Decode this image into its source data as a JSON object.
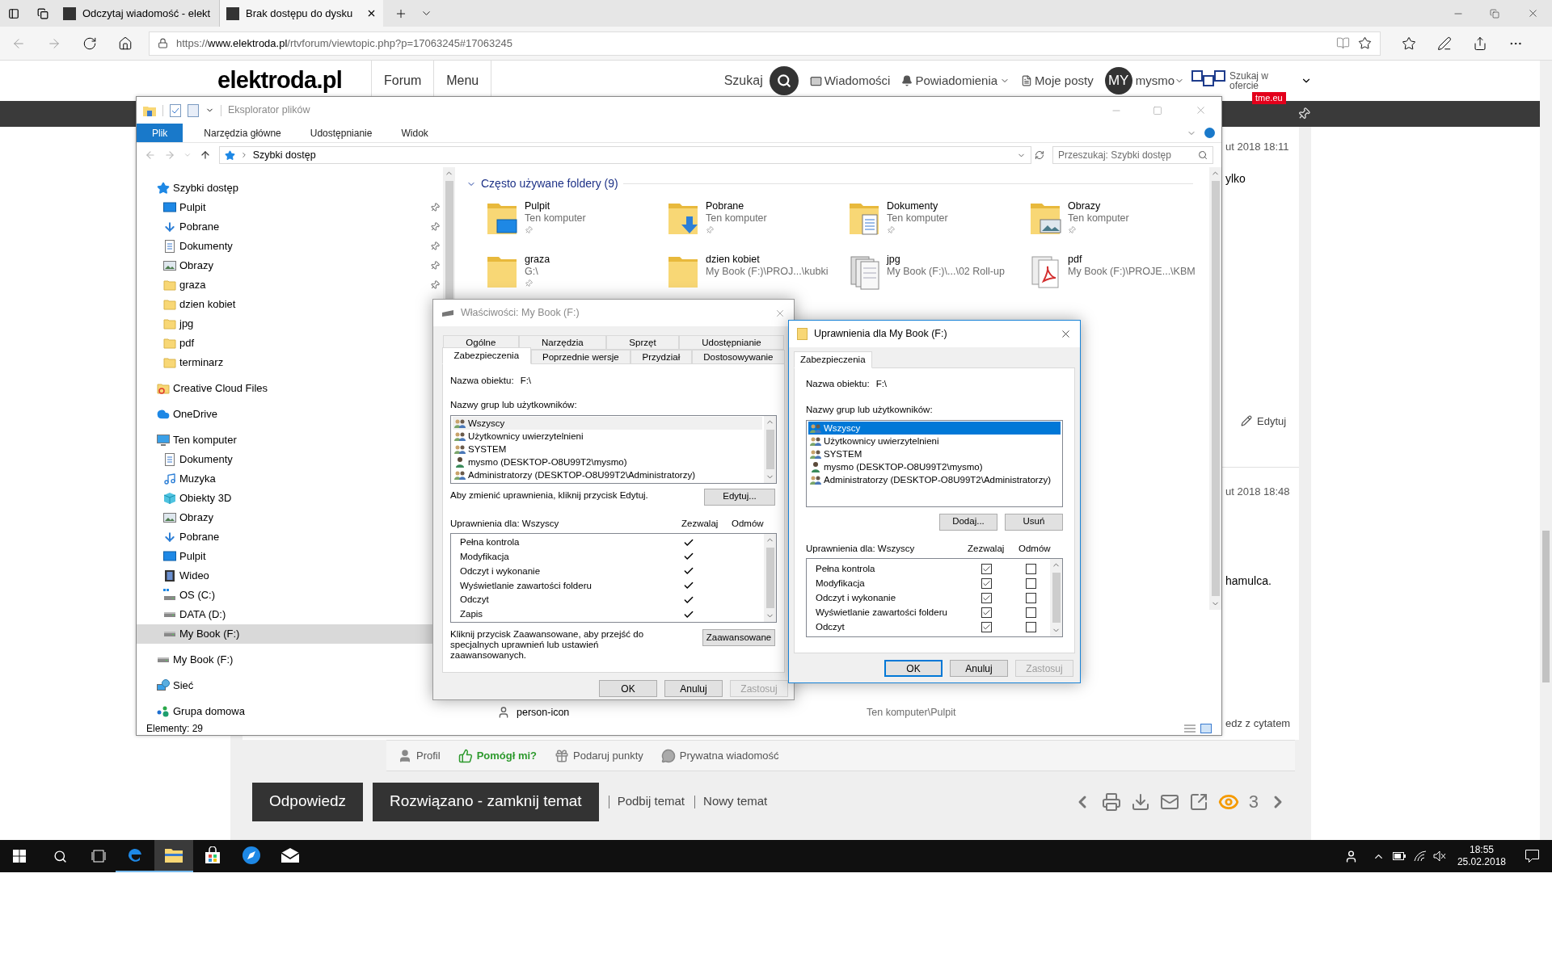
{
  "browser": {
    "tabs": [
      {
        "title": "Odczytaj wiadomość - elekt",
        "selected": false
      },
      {
        "title": "Brak dostępu do dysku",
        "selected": true
      }
    ],
    "url": {
      "scheme": "https://",
      "domain": "www.elektroda.pl",
      "path": "/rtvforum/viewtopic.php?p=17063245#17063245"
    }
  },
  "site": {
    "logo": "elektroda.pl",
    "nav": [
      "Forum",
      "Menu"
    ],
    "search_label": "Szukaj",
    "links": [
      {
        "label": "Wiadomości",
        "kind": "mail"
      },
      {
        "label": "Powiadomienia",
        "kind": "bell"
      },
      {
        "label": "Moje posty",
        "kind": "doc"
      }
    ],
    "avatar": "MY",
    "user": "mysmo",
    "promo": "Szukaj w ofercie",
    "promo_badge": "tme.eu"
  },
  "forum": {
    "posts": [
      {
        "date": "ut 2018 18:11",
        "text": "ylko",
        "action": "Edytuj",
        "kind": "edit"
      },
      {
        "date": "ut 2018 18:48",
        "text": "hamulca.",
        "action": "edz z cytatem",
        "kind": "quote"
      }
    ],
    "post_actions": [
      {
        "label": "Profil",
        "kind": "person"
      },
      {
        "label": "Pomógł mi?",
        "kind": "thumb"
      },
      {
        "label": "Podaruj punkty",
        "kind": "gift"
      },
      {
        "label": "Prywatna wiadomość",
        "kind": "chat"
      }
    ],
    "buttons": [
      "Odpowiedz",
      "Rozwiązano - zamknij temat"
    ],
    "links": [
      "Podbij temat",
      "Nowy temat"
    ],
    "views": "3"
  },
  "explorer": {
    "title": "Eksplorator plików",
    "ribbon_tabs": [
      {
        "label": "Plik",
        "selected": true
      },
      {
        "label": "Narzędzia główne",
        "selected": false
      },
      {
        "label": "Udostępnianie",
        "selected": false
      },
      {
        "label": "Widok",
        "selected": false
      }
    ],
    "path": "Szybki dostęp",
    "search": {
      "placeholder": "Przeszukaj: Szybki dostęp"
    },
    "nav": [
      {
        "label": "Szybki dostęp",
        "kind": "star",
        "selected": false,
        "children": [
          {
            "label": "Pulpit",
            "kind": "desktop",
            "pinned": true,
            "selected": false
          },
          {
            "label": "Pobrane",
            "kind": "download",
            "pinned": true,
            "selected": false
          },
          {
            "label": "Dokumenty",
            "kind": "documents",
            "pinned": true,
            "selected": false
          },
          {
            "label": "Obrazy",
            "kind": "pictures",
            "pinned": true,
            "selected": false
          },
          {
            "label": "graza",
            "kind": "folder",
            "pinned": true,
            "selected": false
          },
          {
            "label": "dzien kobiet",
            "kind": "folder",
            "pinned": false,
            "selected": false
          },
          {
            "label": "jpg",
            "kind": "folder",
            "pinned": false,
            "selected": false
          },
          {
            "label": "pdf",
            "kind": "folder",
            "pinned": false,
            "selected": false
          },
          {
            "label": "terminarz",
            "kind": "folder",
            "pinned": false,
            "selected": false
          }
        ]
      },
      {
        "label": "Creative Cloud Files",
        "kind": "creative",
        "selected": false
      },
      {
        "label": "OneDrive",
        "kind": "cloud",
        "selected": false
      },
      {
        "label": "Ten komputer",
        "kind": "computer",
        "selected": false,
        "children": [
          {
            "label": "Dokumenty",
            "kind": "documents",
            "selected": false
          },
          {
            "label": "Muzyka",
            "kind": "music",
            "selected": false
          },
          {
            "label": "Obiekty 3D",
            "kind": "cube",
            "selected": false
          },
          {
            "label": "Obrazy",
            "kind": "pictures",
            "selected": false
          },
          {
            "label": "Pobrane",
            "kind": "download",
            "selected": false
          },
          {
            "label": "Pulpit",
            "kind": "desktop",
            "selected": false
          },
          {
            "label": "Wideo",
            "kind": "video",
            "selected": false
          },
          {
            "label": "OS (C:)",
            "kind": "drive-os",
            "selected": false
          },
          {
            "label": "DATA (D:)",
            "kind": "drive",
            "selected": false
          },
          {
            "label": "My Book (F:)",
            "kind": "drive",
            "selected": true
          }
        ]
      },
      {
        "label": "My Book (F:)",
        "kind": "drive",
        "selected": false
      },
      {
        "label": "Sieć",
        "kind": "network",
        "selected": false
      },
      {
        "label": "Grupa domowa",
        "kind": "homegroup",
        "selected": false
      }
    ],
    "section": {
      "title": "Często używane foldery (9)",
      "expanded": true
    },
    "folders": [
      {
        "name": "Pulpit",
        "location": "Ten komputer",
        "kind": "desktop",
        "pinned": true
      },
      {
        "name": "Pobrane",
        "location": "Ten komputer",
        "kind": "download",
        "pinned": true
      },
      {
        "name": "Dokumenty",
        "location": "Ten komputer",
        "kind": "documents",
        "pinned": true
      },
      {
        "name": "Obrazy",
        "location": "Ten komputer",
        "kind": "pictures",
        "pinned": true
      },
      {
        "name": "graza",
        "location": "G:\\",
        "kind": "folder",
        "pinned": true
      },
      {
        "name": "dzien kobiet",
        "location": "My Book (F:)\\PROJ...\\kubki",
        "kind": "folder",
        "pinned": false
      },
      {
        "name": "jpg",
        "location": "My Book (F:)\\...\\02 Roll-up",
        "kind": "stack",
        "pinned": false
      },
      {
        "name": "pdf",
        "location": "My Book (F:)\\PROJE...\\KBM",
        "kind": "pdf",
        "pinned": false
      }
    ],
    "recent": [
      {
        "name": "person-icon",
        "location": "Ten komputer\\Pulpit"
      }
    ],
    "status": "Elementy: 29"
  },
  "properties_dialog": {
    "title": "Właściwości: My Book (F:)",
    "active": false,
    "tab_rows": [
      [
        {
          "label": "Ogólne",
          "selected": false
        },
        {
          "label": "Narzędzia",
          "selected": false
        },
        {
          "label": "Sprzęt",
          "selected": false
        },
        {
          "label": "Udostępnianie",
          "selected": false
        }
      ],
      [
        {
          "label": "Zabezpieczenia",
          "selected": true
        },
        {
          "label": "Poprzednie wersje",
          "selected": false
        },
        {
          "label": "Przydział",
          "selected": false
        },
        {
          "label": "Dostosowywanie",
          "selected": false
        }
      ]
    ],
    "object_label": "Nazwa obiektu:",
    "object_value": "F:\\",
    "groups_label": "Nazwy grup lub użytkowników:",
    "users": [
      {
        "name": "Wszyscy",
        "kind": "group",
        "selected": true
      },
      {
        "name": "Użytkownicy uwierzytelnieni",
        "kind": "group",
        "selected": false
      },
      {
        "name": "SYSTEM",
        "kind": "group",
        "selected": false
      },
      {
        "name": "mysmo (DESKTOP-O8U99T2\\mysmo)",
        "kind": "user",
        "selected": false
      },
      {
        "name": "Administratorzy (DESKTOP-O8U99T2\\Administratorzy)",
        "kind": "group",
        "selected": false
      }
    ],
    "edit_hint": "Aby zmienić uprawnienia, kliknij przycisk Edytuj.",
    "edit_button": "Edytuj...",
    "permissions_label": "Uprawnienia dla: Wszyscy",
    "columns": [
      "Zezwalaj",
      "Odmów"
    ],
    "permissions": [
      {
        "name": "Pełna kontrola",
        "allow": true,
        "deny": false
      },
      {
        "name": "Modyfikacja",
        "allow": true,
        "deny": false
      },
      {
        "name": "Odczyt i wykonanie",
        "allow": true,
        "deny": false
      },
      {
        "name": "Wyświetlanie zawartości folderu",
        "allow": true,
        "deny": false
      },
      {
        "name": "Odczyt",
        "allow": true,
        "deny": false
      },
      {
        "name": "Zapis",
        "allow": true,
        "deny": false
      }
    ],
    "advanced_hint": "Kliknij przycisk Zaawansowane, aby przejść do specjalnych uprawnień lub ustawień zaawansowanych.",
    "advanced_button": "Zaawansowane",
    "buttons": [
      {
        "label": "OK",
        "default": false,
        "disabled": false
      },
      {
        "label": "Anuluj",
        "default": false,
        "disabled": false
      },
      {
        "label": "Zastosuj",
        "default": false,
        "disabled": true
      }
    ]
  },
  "permissions_dialog": {
    "title": "Uprawnienia dla My Book (F:)",
    "active": true,
    "tab": "Zabezpieczenia",
    "object_label": "Nazwa obiektu:",
    "object_value": "F:\\",
    "groups_label": "Nazwy grup lub użytkowników:",
    "users": [
      {
        "name": "Wszyscy",
        "kind": "group",
        "selected": true
      },
      {
        "name": "Użytkownicy uwierzytelnieni",
        "kind": "group",
        "selected": false
      },
      {
        "name": "SYSTEM",
        "kind": "group",
        "selected": false
      },
      {
        "name": "mysmo (DESKTOP-O8U99T2\\mysmo)",
        "kind": "user",
        "selected": false
      },
      {
        "name": "Administratorzy (DESKTOP-O8U99T2\\Administratorzy)",
        "kind": "group",
        "selected": false
      }
    ],
    "list_buttons": [
      "Dodaj...",
      "Usuń"
    ],
    "permissions_label": "Uprawnienia dla: Wszyscy",
    "columns": [
      "Zezwalaj",
      "Odmów"
    ],
    "permissions": [
      {
        "name": "Pełna kontrola",
        "allow": true,
        "deny": false
      },
      {
        "name": "Modyfikacja",
        "allow": true,
        "deny": false
      },
      {
        "name": "Odczyt i wykonanie",
        "allow": true,
        "deny": false
      },
      {
        "name": "Wyświetlanie zawartości folderu",
        "allow": true,
        "deny": false
      },
      {
        "name": "Odczyt",
        "allow": true,
        "deny": false
      }
    ],
    "buttons": [
      {
        "label": "OK",
        "default": true,
        "disabled": false
      },
      {
        "label": "Anuluj",
        "default": false,
        "disabled": false
      },
      {
        "label": "Zastosuj",
        "default": false,
        "disabled": true
      }
    ]
  },
  "taskbar": {
    "apps": [
      {
        "kind": "edge",
        "running": true
      },
      {
        "kind": "explorer",
        "running": true
      },
      {
        "kind": "store",
        "running": false
      },
      {
        "kind": "compass",
        "running": false
      },
      {
        "kind": "mail",
        "running": false
      }
    ],
    "time": "18:55",
    "date": "25.02.2018"
  }
}
